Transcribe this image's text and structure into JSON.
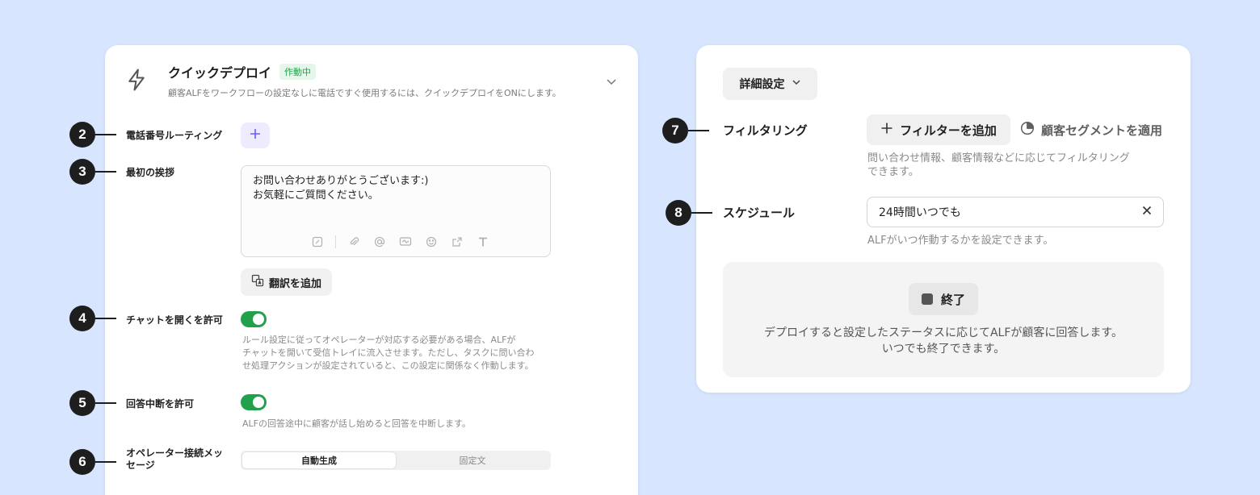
{
  "quick_deploy": {
    "title": "クイックデプロイ",
    "status": "作動中",
    "subtitle": "顧客ALFをワークフローの設定なしに電話ですぐ使用するには、クイックデプロイをONにします。"
  },
  "callouts": [
    "2",
    "3",
    "4",
    "5",
    "6",
    "7",
    "8"
  ],
  "phone_routing": {
    "label": "電話番号ルーティング"
  },
  "greeting": {
    "label": "最初の挨拶",
    "line1": "お問い合わせありがとうございます:)",
    "line2": "お気軽にご質問ください。"
  },
  "translate": {
    "label": "翻訳を追加"
  },
  "open_chat": {
    "label": "チャットを開くを許可",
    "enabled": true,
    "help1": "ルール設定に従ってオペレーターが対応する必要がある場合、ALFが",
    "help2": "チャットを開いて受信トレイに流入させます。ただし、タスクに問い合わ",
    "help3": "せ処理アクションが設定されていると、この設定に関係なく作動します。"
  },
  "interrupt": {
    "label": "回答中断を許可",
    "enabled": true,
    "help": "ALFの回答途中に顧客が話し始めると回答を中断します。"
  },
  "operator_message": {
    "label_line1": "オペレーター接続メッ",
    "label_line2": "セージ",
    "options": [
      "自動生成",
      "固定文"
    ],
    "selected": "自動生成"
  },
  "advanced": {
    "label": "詳細設定"
  },
  "filtering": {
    "label": "フィルタリング",
    "add_filter": "フィルターを追加",
    "apply_segment": "顧客セグメントを適用",
    "help1": "問い合わせ情報、顧客情報などに応じてフィルタリング",
    "help2": "できます。"
  },
  "schedule": {
    "label": "スケジュール",
    "value": "24時間いつでも",
    "help": "ALFがいつ作動するかを設定できます。"
  },
  "end": {
    "label": "終了",
    "desc1": "デプロイすると設定したステータスに応じてALFが顧客に回答します。",
    "desc2": "いつでも終了できます。"
  },
  "colors": {
    "accent_green": "#22a04b",
    "background": "#d7e5fe",
    "plus_purple": "#6a5cff"
  }
}
